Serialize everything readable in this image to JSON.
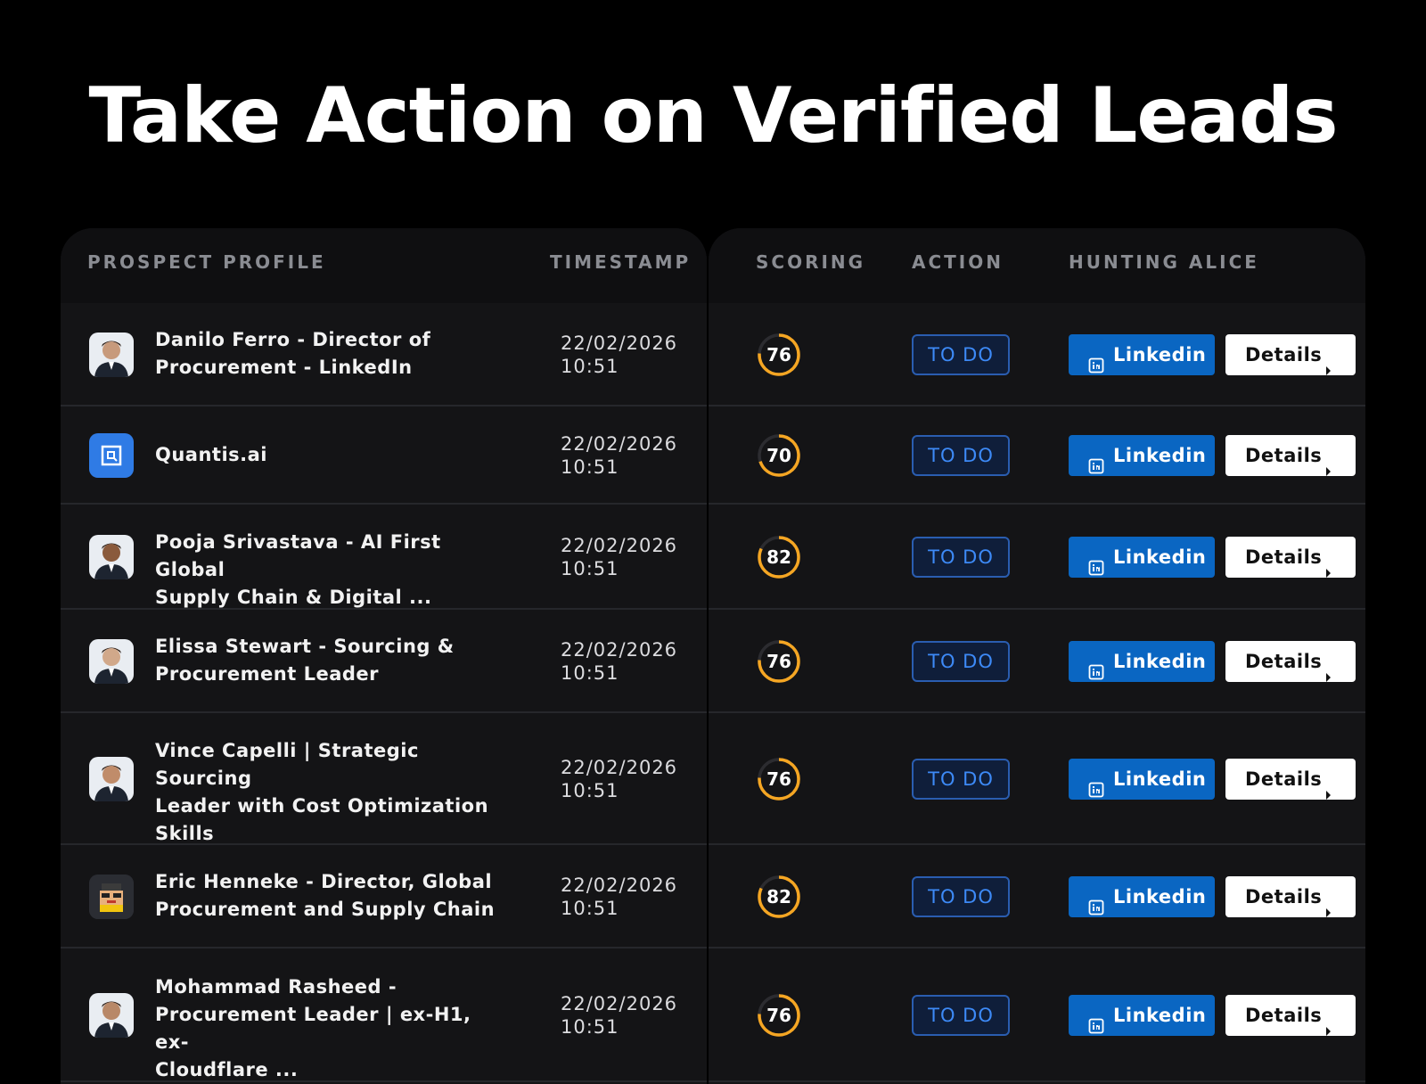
{
  "headline": "Take Action on Verified Leads",
  "columns": {
    "profile": "PROSPECT PROFILE",
    "timestamp": "TIMESTAMP",
    "scoring": "SCORING",
    "action": "ACTION",
    "hunting": "HUNTING ALICE"
  },
  "colors": {
    "background": "#000000",
    "panel": "#141416",
    "score_ring": "#f5a623",
    "todo_text": "#3d8af7",
    "linkedin": "#0a66c2"
  },
  "rows": [
    {
      "name_lines": [
        "Danilo Ferro - Director of",
        "Procurement - LinkedIn",
        ""
      ],
      "avatar": "person-photo",
      "date": "22/02/2026",
      "time": "10:51",
      "score": 76,
      "action": "TO DO",
      "linkedin": "Linkedin",
      "details": "Details"
    },
    {
      "name_lines": [
        "Quantis.ai",
        "",
        ""
      ],
      "avatar": "company-logo",
      "date": "22/02/2026",
      "time": "10:51",
      "score": 70,
      "action": "TO DO",
      "linkedin": "Linkedin",
      "details": "Details"
    },
    {
      "name_lines": [
        "Pooja Srivastava - AI First Global",
        "Supply Chain & Digital ...",
        ""
      ],
      "avatar": "person-photo",
      "date": "22/02/2026",
      "time": "10:51",
      "score": 82,
      "action": "TO DO",
      "linkedin": "Linkedin",
      "details": "Details"
    },
    {
      "name_lines": [
        "Elissa Stewart - Sourcing &",
        "Procurement Leader",
        ""
      ],
      "avatar": "person-photo",
      "date": "22/02/2026",
      "time": "10:51",
      "score": 76,
      "action": "TO DO",
      "linkedin": "Linkedin",
      "details": "Details"
    },
    {
      "name_lines": [
        "Vince Capelli | Strategic Sourcing",
        "Leader with Cost Optimization",
        "Skills"
      ],
      "avatar": "person-photo",
      "date": "22/02/2026",
      "time": "10:51",
      "score": 76,
      "action": "TO DO",
      "linkedin": "Linkedin",
      "details": "Details"
    },
    {
      "name_lines": [
        "Eric Henneke - Director, Global",
        "Procurement and Supply Chain",
        ""
      ],
      "avatar": "pixel-avatar",
      "date": "22/02/2026",
      "time": "10:51",
      "score": 82,
      "action": "TO DO",
      "linkedin": "Linkedin",
      "details": "Details"
    },
    {
      "name_lines": [
        "Mohammad Rasheed -",
        "Procurement Leader | ex-H1, ex-",
        "Cloudflare ..."
      ],
      "avatar": "person-photo",
      "date": "22/02/2026",
      "time": "10:51",
      "score": 76,
      "action": "TO DO",
      "linkedin": "Linkedin",
      "details": "Details"
    }
  ]
}
